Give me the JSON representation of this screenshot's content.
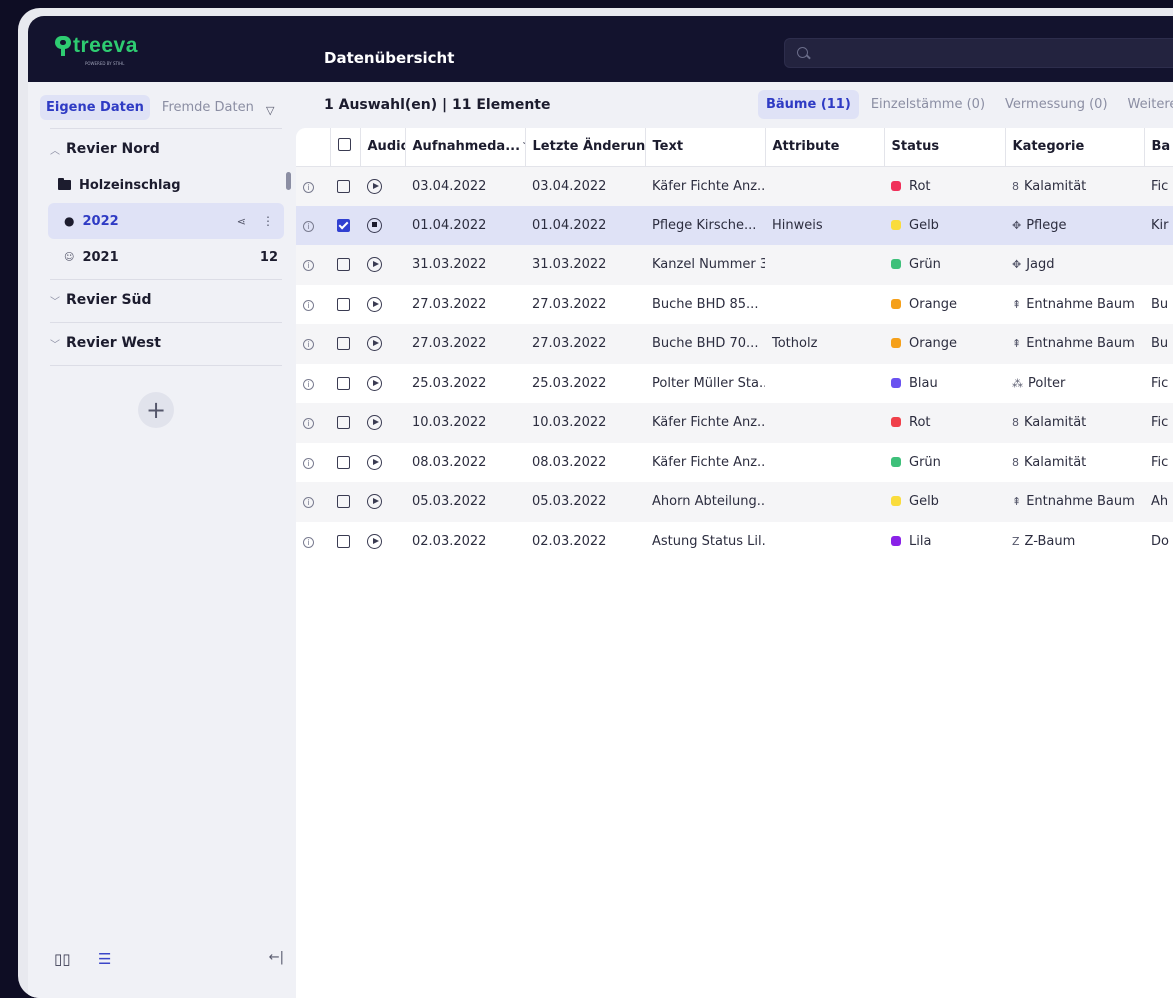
{
  "app": {
    "logo_text": "treeva",
    "logo_sub": "POWERED BY STIHL",
    "page_title": "Datenübersicht",
    "search_placeholder": ""
  },
  "sidebar": {
    "tabs": [
      {
        "label": "Eigene Daten",
        "active": true
      },
      {
        "label": "Fremde Daten",
        "active": false
      }
    ],
    "regions": [
      {
        "label": "Revier Nord",
        "expanded": true
      },
      {
        "label": "Revier Süd",
        "expanded": false
      },
      {
        "label": "Revier West",
        "expanded": false
      }
    ],
    "folder": {
      "label": "Holzeinschlag"
    },
    "years": [
      {
        "label": "2022",
        "active": true,
        "count": ""
      },
      {
        "label": "2021",
        "active": false,
        "count": "12"
      }
    ],
    "add_label": "+"
  },
  "toolbar": {
    "selection_info": "1 Auswahl(en) | 11 Elemente",
    "type_tabs": [
      {
        "label": "Bäume (11)",
        "active": true
      },
      {
        "label": "Einzelstämme (0)",
        "active": false
      },
      {
        "label": "Vermessung (0)",
        "active": false
      },
      {
        "label": "Weiteres (",
        "active": false
      }
    ]
  },
  "table": {
    "columns": [
      "",
      "",
      "Audio",
      "Aufnahmeda...",
      "Letzte Änderung",
      "Text",
      "Attribute",
      "Status",
      "Kategorie",
      "Ba"
    ],
    "rows": [
      {
        "date": "03.04.2022",
        "changed": "03.04.2022",
        "text": "Käfer Fichte Anz..",
        "attr": "",
        "status": "Rot",
        "status_color": "#f0305a",
        "cat_icon": "8",
        "cat": "Kalamität",
        "ba": "Fic",
        "checked": false,
        "audio": "play"
      },
      {
        "date": "01.04.2022",
        "changed": "01.04.2022",
        "text": "Pflege Kirsche...",
        "attr": "Hinweis",
        "status": "Gelb",
        "status_color": "#fadc3c",
        "cat_icon": "✥",
        "cat": "Pflege",
        "ba": "Kir",
        "checked": true,
        "audio": "stop"
      },
      {
        "date": "31.03.2022",
        "changed": "31.03.2022",
        "text": "Kanzel Nummer 3...",
        "attr": "",
        "status": "Grün",
        "status_color": "#3ec07a",
        "cat_icon": "✥",
        "cat": "Jagd",
        "ba": "",
        "checked": false,
        "audio": "play"
      },
      {
        "date": "27.03.2022",
        "changed": "27.03.2022",
        "text": "Buche BHD 85...",
        "attr": "",
        "status": "Orange",
        "status_color": "#f5a01a",
        "cat_icon": "⇞",
        "cat": "Entnahme Baum",
        "ba": "Bu",
        "checked": false,
        "audio": "play"
      },
      {
        "date": "27.03.2022",
        "changed": "27.03.2022",
        "text": "Buche BHD 70...",
        "attr": "Totholz",
        "status": "Orange",
        "status_color": "#f5a01a",
        "cat_icon": "⇞",
        "cat": "Entnahme Baum",
        "ba": "Bu",
        "checked": false,
        "audio": "play"
      },
      {
        "date": "25.03.2022",
        "changed": "25.03.2022",
        "text": "Polter Müller Sta...",
        "attr": "",
        "status": "Blau",
        "status_color": "#6a52f0",
        "cat_icon": "⁂",
        "cat": "Polter",
        "ba": "Fic",
        "checked": false,
        "audio": "play"
      },
      {
        "date": "10.03.2022",
        "changed": "10.03.2022",
        "text": "Käfer Fichte Anz...",
        "attr": "",
        "status": "Rot",
        "status_color": "#f0404a",
        "cat_icon": "8",
        "cat": "Kalamität",
        "ba": "Fic",
        "checked": false,
        "audio": "play"
      },
      {
        "date": "08.03.2022",
        "changed": "08.03.2022",
        "text": "Käfer Fichte Anz...",
        "attr": "",
        "status": "Grün",
        "status_color": "#3ec07a",
        "cat_icon": "8",
        "cat": "Kalamität",
        "ba": "Fic",
        "checked": false,
        "audio": "play"
      },
      {
        "date": "05.03.2022",
        "changed": "05.03.2022",
        "text": "Ahorn Abteilung...",
        "attr": "",
        "status": "Gelb",
        "status_color": "#fadc3c",
        "cat_icon": "⇞",
        "cat": "Entnahme Baum",
        "ba": "Ah",
        "checked": false,
        "audio": "play"
      },
      {
        "date": "02.03.2022",
        "changed": "02.03.2022",
        "text": "Astung Status Lil...",
        "attr": "",
        "status": "Lila",
        "status_color": "#8a22e8",
        "cat_icon": "Z",
        "cat": "Z-Baum",
        "ba": "Do",
        "checked": false,
        "audio": "play"
      }
    ]
  },
  "colors": {
    "accent": "#2f3bc4",
    "topbar": "#13132e",
    "logo_green": "#2ecc71"
  }
}
